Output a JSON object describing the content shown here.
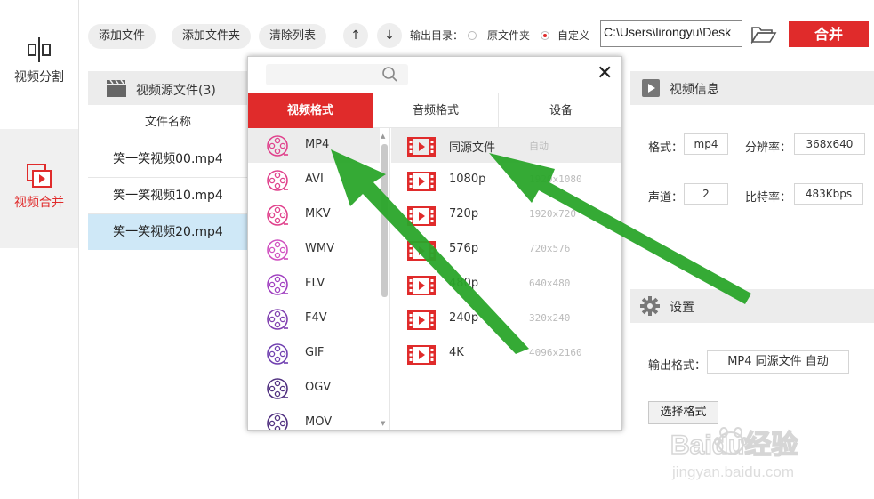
{
  "nav": {
    "items": [
      {
        "label": "视频分割"
      },
      {
        "label": "视频合并"
      }
    ]
  },
  "toolbar": {
    "add_file": "添加文件",
    "add_folder": "添加文件夹",
    "clear_list": "清除列表",
    "up": "↑",
    "down": "↓",
    "output_dir_label": "输出目录：",
    "option_source": "原文件夹",
    "option_custom": "自定义",
    "path_value": "C:\\Users\\lirongyu\\Desk",
    "merge": "合并"
  },
  "file_panel": {
    "title": "视频源文件(3)",
    "column": "文件名称",
    "files": [
      "笑一笑视频00.mp4",
      "笑一笑视频10.mp4",
      "笑一笑视频20.mp4"
    ]
  },
  "info": {
    "title": "视频信息",
    "format_label": "格式：",
    "format_value": "mp4",
    "resolution_label": "分辨率：",
    "resolution_value": "368x640",
    "channels_label": "声道：",
    "channels_value": "2",
    "bitrate_label": "比特率：",
    "bitrate_value": "483Kbps"
  },
  "settings": {
    "title": "设置",
    "output_format_label": "输出格式：",
    "output_format_value": "MP4 同源文件 自动",
    "choose_format": "选择格式"
  },
  "popup": {
    "tabs": [
      "视频格式",
      "音频格式",
      "设备"
    ],
    "formats": [
      "MP4",
      "AVI",
      "MKV",
      "WMV",
      "FLV",
      "F4V",
      "GIF",
      "OGV",
      "MOV"
    ],
    "resolutions": [
      {
        "name": "同源文件",
        "detail": "自动"
      },
      {
        "name": "1080p",
        "detail": "1920x1080"
      },
      {
        "name": "720p",
        "detail": "1920x720"
      },
      {
        "name": "576p",
        "detail": "720x576"
      },
      {
        "name": "480p",
        "detail": "640x480"
      },
      {
        "name": "240p",
        "detail": "320x240"
      },
      {
        "name": "4K",
        "detail": "4096x2160"
      }
    ],
    "close": "✕"
  },
  "watermark": {
    "brand": "Baidu经验",
    "url": "jingyan.baidu.com"
  },
  "colors": {
    "accent": "#e02b2b",
    "selected_row": "#cfe8f7",
    "arrow": "#2aa52a",
    "format_icons": [
      "#e0418c",
      "#e0418c",
      "#e0418c",
      "#d050c0",
      "#a040c0",
      "#8040b0",
      "#7040b0",
      "#503080",
      "#503080"
    ]
  }
}
